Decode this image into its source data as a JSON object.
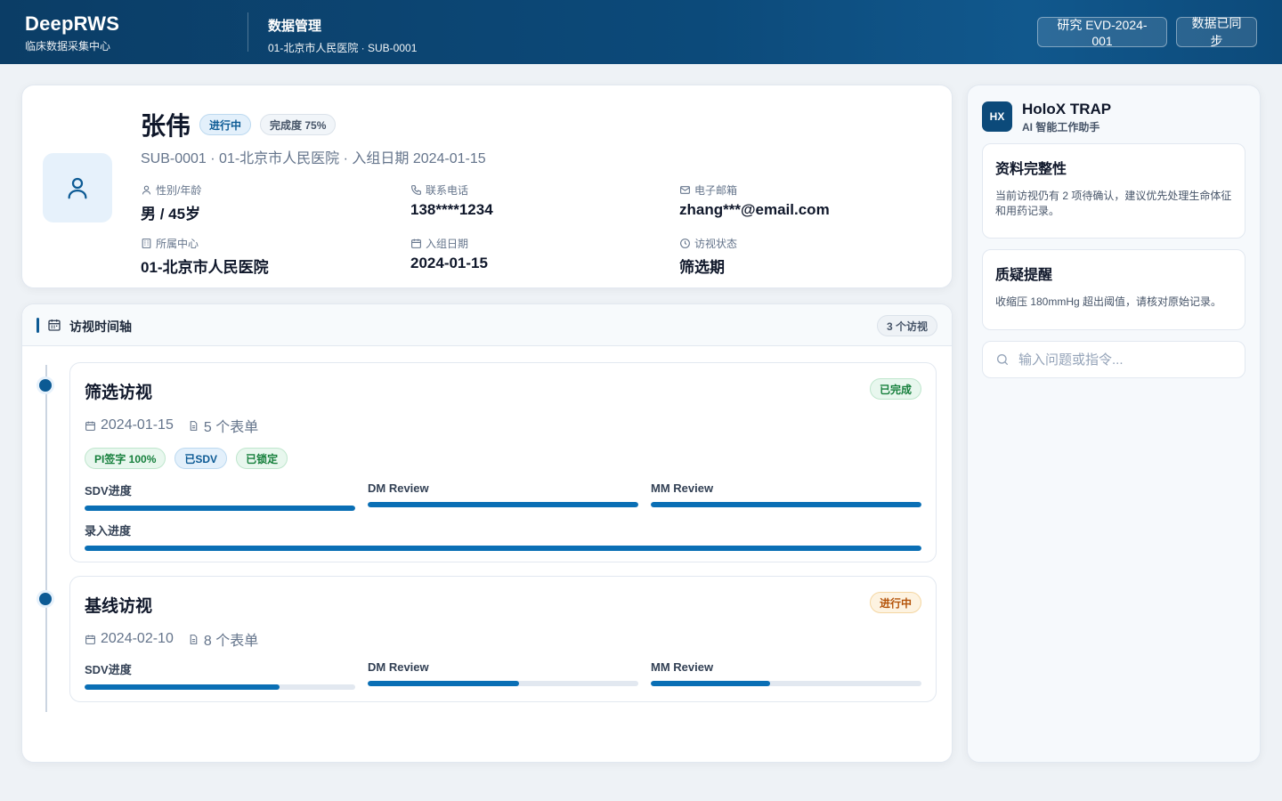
{
  "header": {
    "brand": "DeepRWS",
    "brand_sub": "临床数据采集中心",
    "section_title": "数据管理",
    "section_sub": "01-北京市人民医院 · SUB-0001",
    "study_button": "研究 EVD-2024-001",
    "sync_button": "数据已同步"
  },
  "patient": {
    "name": "张伟",
    "status_badge": "进行中",
    "completion_badge": "完成度 75%",
    "subline": "SUB-0001 · 01-北京市人民医院 · 入组日期 2024-01-15",
    "fields": {
      "gender_age": {
        "label": "性别/年龄",
        "value": "男 / 45岁",
        "icon": "user-icon"
      },
      "phone": {
        "label": "联系电话",
        "value": "138****1234",
        "icon": "phone-icon"
      },
      "email": {
        "label": "电子邮箱",
        "value": "zhang***@email.com",
        "icon": "mail-icon"
      },
      "center": {
        "label": "所属中心",
        "value": "01-北京市人民医院",
        "icon": "building-icon"
      },
      "enroll_date": {
        "label": "入组日期",
        "value": "2024-01-15",
        "icon": "calendar-icon"
      },
      "visit_status": {
        "label": "访视状态",
        "value": "筛选期",
        "icon": "clock-icon"
      }
    }
  },
  "timeline": {
    "title": "访视时间轴",
    "count": "3 个访视",
    "visits": [
      {
        "title": "筛选访视",
        "status": "已完成",
        "date": "2024-01-15",
        "forms": "5 个表单",
        "tags": [
          "PI签字 100%",
          "已SDV",
          "已锁定"
        ],
        "progress": [
          {
            "label": "SDV进度",
            "value": 1.0
          },
          {
            "label": "DM Review",
            "value": 1.0
          },
          {
            "label": "MM Review",
            "value": 1.0
          },
          {
            "label": "录入进度",
            "value": 1.0
          }
        ]
      },
      {
        "title": "基线访视",
        "status": "进行中",
        "date": "2024-02-10",
        "forms": "8 个表单",
        "tags": [],
        "progress": [
          {
            "label": "SDV进度",
            "value": 0.72
          },
          {
            "label": "DM Review",
            "value": 0.56
          },
          {
            "label": "MM Review",
            "value": 0.44
          }
        ]
      }
    ]
  },
  "assistant": {
    "logo": "HX",
    "name": "HoloX TRAP",
    "sub": "AI 智能工作助手",
    "tips": [
      {
        "title": "资料完整性",
        "body": "当前访视仍有 2 项待确认，建议优先处理生命体征和用药记录。"
      },
      {
        "title": "质疑提醒",
        "body": "收缩压 180mmHg 超出阈值，请核对原始记录。"
      }
    ],
    "input_placeholder": "输入问题或指令..."
  },
  "colors": {
    "brand": "#0c4a7a",
    "accent": "#0a6fb5",
    "success": "#17803d",
    "warning": "#b45309"
  }
}
